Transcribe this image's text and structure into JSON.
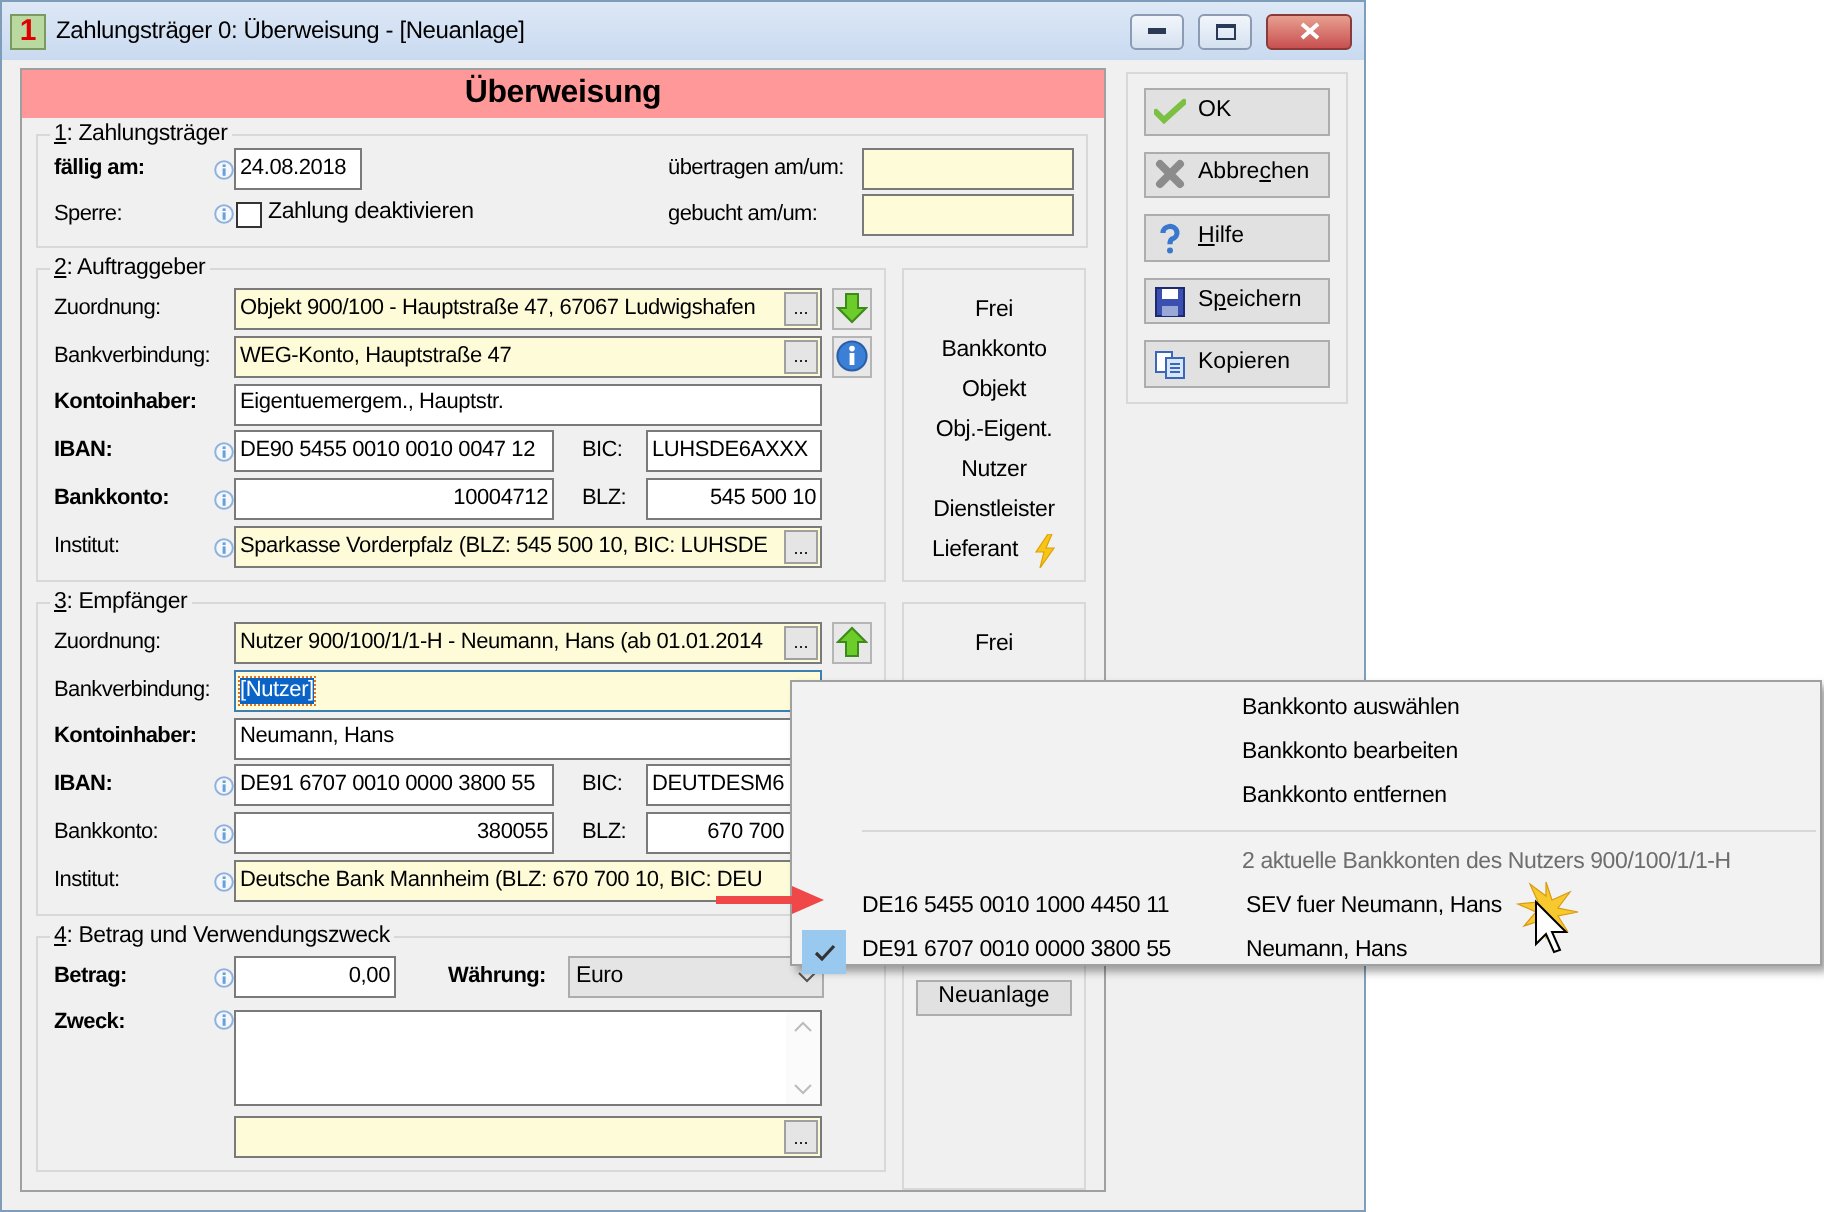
{
  "window": {
    "icon_label": "1",
    "title": "Zahlungsträger 0: Überweisung - [Neuanlage]"
  },
  "header": "Überweisung",
  "section_1": {
    "legend": {
      "key": "1",
      "text": ": Zahlungsträger"
    },
    "due": {
      "label": "fällig am:",
      "value": "24.08.2018"
    },
    "lock": {
      "label": "Sperre:",
      "checkbox_label": "Zahlung deaktivieren",
      "checked": false
    },
    "transferred": {
      "label": "übertragen am/um:"
    },
    "booked": {
      "label": "gebucht am/um:"
    }
  },
  "parties": [
    {
      "legend": {
        "key": "2",
        "text": ": Auftraggeber"
      },
      "rows": [
        {
          "kind": "lookup",
          "label": "Zuordnung:",
          "bold": false,
          "info": false,
          "value": "Objekt 900/100 - Hauptstraße 47, 67067 Ludwigshafen",
          "button": "..."
        },
        {
          "kind": "lookup",
          "label": "Bankverbindung:",
          "bold": false,
          "info": false,
          "value": "WEG-Konto,  Hauptstraße 47",
          "button": "...",
          "focused": false
        },
        {
          "kind": "text",
          "label": "Kontoinhaber:",
          "bold": true,
          "info": false,
          "value": "Eigentuemergem., Hauptstr."
        },
        {
          "kind": "pair",
          "label": "IBAN:",
          "bold": true,
          "info": true,
          "value": "DE90 5455 0010 0010 0047 12",
          "second_label": "BIC:",
          "second_value": "LUHSDE6AXXX"
        },
        {
          "kind": "pair",
          "label": "Bankkonto:",
          "bold": true,
          "info": true,
          "value": "10004712",
          "second_label": "BLZ:",
          "second_value": "545 500 10"
        },
        {
          "kind": "lookup",
          "label": "Institut:",
          "bold": false,
          "info": true,
          "value": "Sparkasse Vorderpfalz  (BLZ: 545 500 10,  BIC: LUHSDE",
          "button": "..."
        }
      ],
      "roles": [
        {
          "label": "Frei",
          "flash": false
        },
        {
          "label": "Bankkonto",
          "flash": false
        },
        {
          "label": "Objekt",
          "flash": false
        },
        {
          "label": "Obj.-Eigent.",
          "flash": false
        },
        {
          "label": "Nutzer",
          "flash": false
        },
        {
          "label": "Dienstleister",
          "flash": false
        },
        {
          "label": "Lieferant",
          "flash": true
        }
      ]
    },
    {
      "legend": {
        "key": "3",
        "text": ": Empfänger"
      },
      "rows": [
        {
          "kind": "lookup",
          "label": "Zuordnung:",
          "bold": false,
          "info": false,
          "value": "Nutzer 900/100/1/1-H - Neumann, Hans  (ab 01.01.2014",
          "button": "..."
        },
        {
          "kind": "lookup",
          "label": "Bankverbindung:",
          "bold": false,
          "info": false,
          "value": "[Nutzer]",
          "focused": true
        },
        {
          "kind": "text",
          "label": "Kontoinhaber:",
          "bold": true,
          "info": false,
          "value": "Neumann, Hans"
        },
        {
          "kind": "pair",
          "label": "IBAN:",
          "bold": true,
          "info": true,
          "value": "DE91 6707 0010 0000 3800 55",
          "second_label": "BIC:",
          "second_value": "DEUTDESM6"
        },
        {
          "kind": "pair",
          "label": "Bankkonto:",
          "bold": false,
          "info": true,
          "value": "380055",
          "second_label": "BLZ:",
          "second_value": "670 700"
        },
        {
          "kind": "lookup",
          "label": "Institut:",
          "bold": false,
          "info": true,
          "value": "Deutsche Bank Mannheim  (BLZ: 670 700 10,  BIC: DEU"
        }
      ],
      "roles": [
        {
          "label": "Frei",
          "flash": false
        }
      ],
      "new_button": "Neuanlage"
    }
  ],
  "section_4": {
    "legend": {
      "key": "4",
      "text": ": Betrag und Verwendungszweck"
    },
    "amount": {
      "label": "Betrag:",
      "value": "0,00"
    },
    "currency": {
      "label": "Währung:",
      "value": "Euro"
    },
    "purpose": {
      "label": "Zweck:"
    },
    "purpose_button": "..."
  },
  "buttons": [
    {
      "before": "OK"
    },
    {
      "before": "Abbre",
      "key": "c",
      "after": "hen"
    },
    {
      "key": "H",
      "after": "ilfe"
    },
    {
      "before": "S",
      "key": "p",
      "after": "eichern"
    },
    {
      "before": "Kopieren"
    }
  ],
  "menu": {
    "actions": [
      {
        "label": "Bankkonto auswählen"
      },
      {
        "label": "Bankkonto bearbeiten"
      },
      {
        "label": "Bankkonto entfernen"
      }
    ],
    "heading": "2 aktuelle Bankkonten des Nutzers 900/100/1/1-H",
    "accounts": [
      {
        "iban": "DE16 5455 0010 1000 4450 11",
        "name": "SEV fuer Neumann, Hans",
        "checked": false
      },
      {
        "iban": "DE91 6707 0010 0000 3800 55",
        "name": "Neumann, Hans",
        "checked": true
      }
    ]
  }
}
